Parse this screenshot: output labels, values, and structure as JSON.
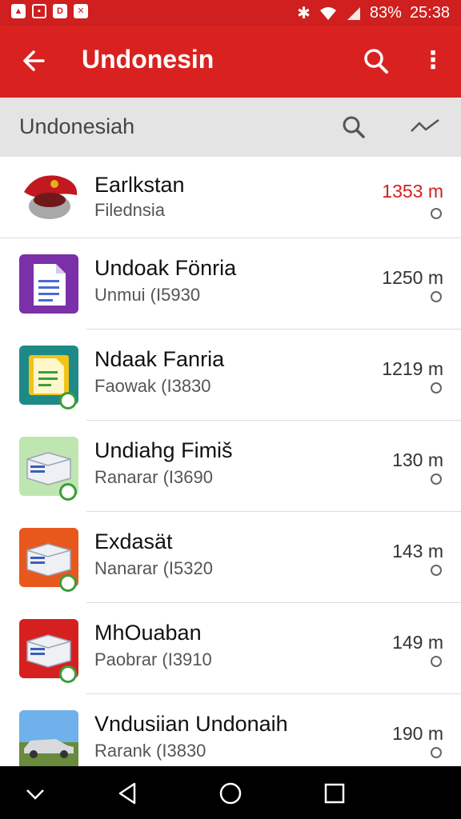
{
  "status_bar": {
    "battery": "83%",
    "time": "25:38",
    "left_icons": [
      "notification-icon",
      "media-icon",
      "app-icon",
      "shop-icon"
    ],
    "right_icons": [
      "bluetooth-icon",
      "wifi-icon",
      "signal-icon"
    ]
  },
  "app_bar": {
    "title": "Undonesin",
    "back_icon": "arrow-left-icon",
    "search_icon": "search-icon",
    "more_icon": "more-vert-icon",
    "color": "#d9221f"
  },
  "sub_header": {
    "title": "Undonesiah",
    "search_icon": "search-icon",
    "trend_icon": "trend-icon"
  },
  "list": [
    {
      "title": "Earlkstan",
      "subtitle": "Filednsia",
      "distance": "1353 m",
      "distance_color": "#d62020",
      "icon": "red-cap-icon"
    },
    {
      "title": "Undoak Fönria",
      "subtitle": "Unmui (I5930",
      "distance": "1250 m",
      "icon": "document-icon-purple"
    },
    {
      "title": "Ndaak Fanria",
      "subtitle": "Faowak (I3830",
      "distance": "1219 m",
      "icon": "document-icon-teal"
    },
    {
      "title": "Undiahg Fimiš",
      "subtitle": "Ranarar (I3690",
      "distance": "130 m",
      "icon": "box-icon-green"
    },
    {
      "title": "Exdasät",
      "subtitle": "Nanarar (I5320",
      "distance": "143 m",
      "icon": "box-icon-orange"
    },
    {
      "title": "MhOuaban",
      "subtitle": "Paobrar (I3910",
      "distance": "149 m",
      "icon": "box-icon-red"
    },
    {
      "title": "Vndusiian Undonaih",
      "subtitle": "Rarank (I3830",
      "distance": "190 m",
      "icon": "car-photo"
    }
  ],
  "nav_bar": {
    "items": [
      "chevron-down-icon",
      "back-triangle-icon",
      "home-circle-icon",
      "recents-square-icon"
    ]
  }
}
